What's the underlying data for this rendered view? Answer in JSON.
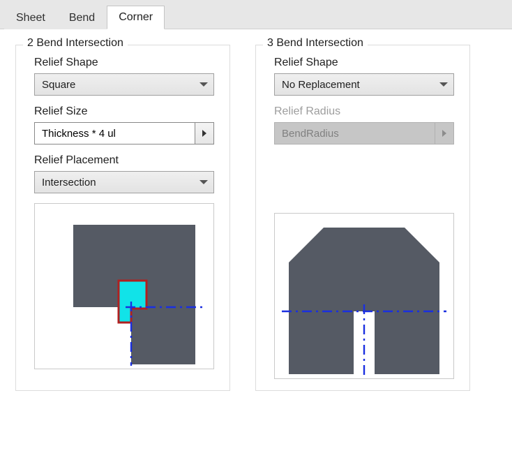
{
  "tabs": {
    "items": [
      {
        "label": "Sheet",
        "active": false
      },
      {
        "label": "Bend",
        "active": false
      },
      {
        "label": "Corner",
        "active": true
      }
    ]
  },
  "left_group": {
    "title": "2 Bend Intersection",
    "shape_label": "Relief Shape",
    "shape_value": "Square",
    "size_label": "Relief Size",
    "size_value": "Thickness * 4 ul",
    "placement_label": "Relief Placement",
    "placement_value": "Intersection"
  },
  "right_group": {
    "title": "3 Bend Intersection",
    "shape_label": "Relief Shape",
    "shape_value": "No Replacement",
    "radius_label": "Relief Radius",
    "radius_value": "BendRadius",
    "radius_enabled": false
  }
}
